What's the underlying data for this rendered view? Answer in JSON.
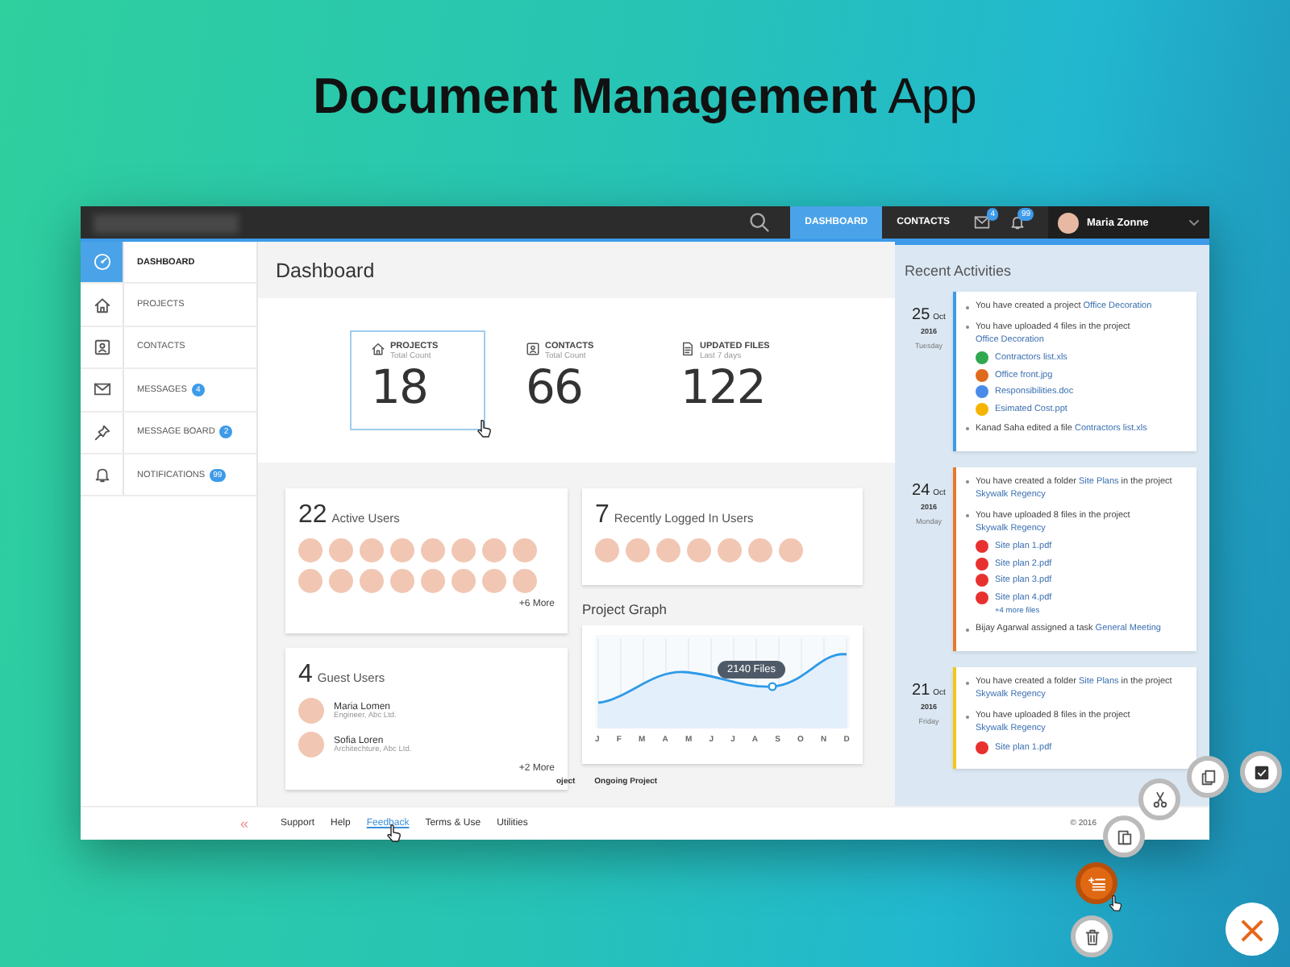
{
  "headline": "**Document Management** App",
  "topbar": {
    "tabs": [
      {
        "label": "DASHBOARD",
        "selected": true
      },
      {
        "label": "CONTACTS",
        "selected": false
      }
    ],
    "mail_badge": "4",
    "bell_badge": "99",
    "user": "Maria Zonne"
  },
  "sidebar": {
    "items": [
      {
        "label": "DASHBOARD",
        "selected": true
      },
      {
        "label": "PROJECTS",
        "selected": false
      },
      {
        "label": "CONTACTS",
        "selected": false
      },
      {
        "label": "MESSAGES",
        "badge": "4",
        "selected": false
      },
      {
        "label": "MESSAGE BOARD",
        "badge": "2",
        "selected": false
      },
      {
        "label": "NOTIFICATIONS",
        "badge": "99",
        "selected": false
      }
    ],
    "collapse": "«"
  },
  "page_title": "Dashboard",
  "stats": [
    {
      "label": "PROJECTS",
      "sublabel": "Total Count",
      "value": "18",
      "selected": true
    },
    {
      "label": "CONTACTS",
      "sublabel": "Total Count",
      "value": "66",
      "selected": false
    },
    {
      "label": "UPDATED FILES",
      "sublabel": "Last 7 days",
      "value": "122",
      "selected": false
    }
  ],
  "active_users": {
    "count": "22",
    "title": "Active Users",
    "avatars": [
      {
        "kind": "photo"
      },
      {
        "kind": "photo"
      },
      {
        "kind": "photo"
      },
      {
        "kind": "photo"
      },
      {
        "kind": "photo"
      },
      {
        "kind": "photo"
      },
      {
        "kind": "photo"
      },
      {
        "kind": "photo"
      },
      {
        "kind": "photo"
      },
      {
        "kind": "photo"
      },
      {
        "kind": "photo"
      },
      {
        "kind": "photo"
      },
      {
        "kind": "photo"
      },
      {
        "kind": "photo"
      },
      {
        "kind": "photo"
      },
      {
        "kind": "photo"
      }
    ],
    "more": "+6 More"
  },
  "recent_users": {
    "count": "7",
    "title": "Recently Logged In Users",
    "avatars": [
      {
        "kind": "photo"
      },
      {
        "kind": "photo"
      },
      {
        "kind": "photo"
      },
      {
        "kind": "photo"
      },
      {
        "kind": "photo"
      },
      {
        "kind": "photo"
      },
      {
        "kind": "photo"
      }
    ]
  },
  "guest_users": {
    "count": "4",
    "title": "Guest Users",
    "users": [
      {
        "name": "Maria Lomen",
        "role": "Engineer, Abc Ltd."
      },
      {
        "name": "Sofia Loren",
        "role": "Architechture, Abc Ltd."
      }
    ],
    "more": "+2 More"
  },
  "project_graph": {
    "title": "Project Graph",
    "tooltip": "2140 Files",
    "months": [
      "J",
      "F",
      "M",
      "A",
      "M",
      "J",
      "J",
      "A",
      "S",
      "O",
      "N",
      "D"
    ]
  },
  "project_tabs": [
    "oject",
    "Ongoing Project"
  ],
  "recent_activities": {
    "title": "Recent Activities",
    "days": [
      {
        "day": "25",
        "month": "Oct",
        "year": "2016",
        "weekday": "Tuesday",
        "color": "#3d9be9",
        "entries": [
          {
            "segments": [
              {
                "text": "You have created a project "
              },
              {
                "link": "Office Decoration"
              }
            ]
          },
          {
            "segments": [
              {
                "text": "You have uploaded 4 files in the project "
              },
              {
                "link": "Office Decoration"
              }
            ],
            "files": [
              {
                "kind": "xls",
                "name": "Contractors list.xls"
              },
              {
                "kind": "jpg",
                "name": "Office front.jpg"
              },
              {
                "kind": "doc",
                "name": "Responsibilities.doc"
              },
              {
                "kind": "ppt",
                "name": "Esimated Cost.ppt"
              }
            ]
          },
          {
            "segments": [
              {
                "text": "Kanad Saha edited a file "
              },
              {
                "link": "Contractors list.xls"
              }
            ]
          }
        ]
      },
      {
        "day": "24",
        "month": "Oct",
        "year": "2016",
        "weekday": "Monday",
        "color": "#e8782a",
        "entries": [
          {
            "segments": [
              {
                "text": "You have created a folder "
              },
              {
                "link": "Site Plans"
              },
              {
                "text": " in the project "
              },
              {
                "link": "Skywalk Regency"
              }
            ]
          },
          {
            "segments": [
              {
                "text": "You have uploaded 8 files in the project "
              },
              {
                "link": "Skywalk Regency"
              }
            ],
            "files": [
              {
                "kind": "pdf",
                "name": "Site plan 1.pdf"
              },
              {
                "kind": "pdf",
                "name": "Site plan 2.pdf"
              },
              {
                "kind": "pdf",
                "name": "Site plan 3.pdf"
              },
              {
                "kind": "pdf",
                "name": "Site plan 4.pdf"
              }
            ],
            "more": "+4 more files"
          },
          {
            "segments": [
              {
                "text": "Bijay Agarwal assigned a task "
              },
              {
                "link": "General Meeting"
              }
            ]
          }
        ]
      },
      {
        "day": "21",
        "month": "Oct",
        "year": "2016",
        "weekday": "Friday",
        "color": "#f5c518",
        "entries": [
          {
            "segments": [
              {
                "text": "You have created a folder "
              },
              {
                "link": "Site Plans"
              },
              {
                "text": " in the project "
              },
              {
                "link": "Skywalk Regency"
              }
            ]
          },
          {
            "segments": [
              {
                "text": "You have uploaded 8 files in the project "
              },
              {
                "link": "Skywalk Regency"
              }
            ],
            "files": [
              {
                "kind": "pdf",
                "name": "Site plan 1.pdf"
              }
            ]
          }
        ]
      }
    ]
  },
  "footer": {
    "links": [
      {
        "label": "Support",
        "selected": false
      },
      {
        "label": "Help",
        "selected": false
      },
      {
        "label": "Feedback",
        "selected": true
      },
      {
        "label": "Terms & Use",
        "selected": false
      },
      {
        "label": "Utilities",
        "selected": false
      }
    ],
    "copyright": "© 2016"
  },
  "fab_menu": {
    "items": [
      {
        "kind": "check",
        "selected": false
      },
      {
        "kind": "copy",
        "selected": false
      },
      {
        "kind": "cut",
        "selected": false
      },
      {
        "kind": "paste",
        "selected": false
      },
      {
        "kind": "add-list",
        "selected": true
      },
      {
        "kind": "delete",
        "selected": false
      }
    ],
    "close": "×"
  }
}
